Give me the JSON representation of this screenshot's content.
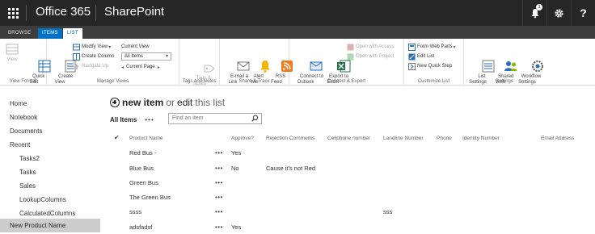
{
  "suite": {
    "app_launcher_icon": "waffle-icon",
    "office_title": "Office 365",
    "app_title": "SharePoint",
    "notification_count": "1",
    "icons": [
      "bell-icon",
      "gear-icon",
      "help-icon"
    ],
    "help_glyph": "?"
  },
  "ribbon_tabs": [
    {
      "label": "BROWSE"
    },
    {
      "label": "ITEMS"
    },
    {
      "label": "LIST"
    }
  ],
  "ribbon": {
    "view_format": {
      "label": "View Format",
      "view": "View",
      "quick_edit": "Quick\nEdit"
    },
    "manage_views": {
      "label": "Manage Views",
      "create_view": "Create\nView",
      "modify_view": "Modify View",
      "create_column": "Create Column",
      "navigate_up": "Navigate Up",
      "current_view_label": "Current View",
      "current_view_value": "All Items",
      "current_page": "Current Page"
    },
    "tags_notes": {
      "label": "Tags and Notes",
      "tags_notes_btn": "Tags &\nNotes"
    },
    "share_track": {
      "label": "Share & Track",
      "email_link": "E-mail a\nLink",
      "alert_me": "Alert\nMe",
      "rss_feed": "RSS\nFeed"
    },
    "connect_export": {
      "label": "Connect & Export",
      "connect_outlook": "Connect to\nOutlook",
      "export_excel": "Export to\nExcel",
      "open_access": "Open with Access",
      "open_project": "Open with Project"
    },
    "customize_list": {
      "label": "Customize List",
      "form_web_parts": "Form Web Parts",
      "edit_list": "Edit List",
      "new_quick_step": "New Quick Step"
    },
    "settings": {
      "label": "Settings",
      "list_settings": "List\nSettings",
      "shared_with": "Shared\nWith",
      "workflow_settings": "Workflow\nSettings"
    }
  },
  "leftnav": [
    {
      "label": "Home"
    },
    {
      "label": "Notebook"
    },
    {
      "label": "Documents"
    },
    {
      "label": "Recent"
    },
    {
      "label": "Tasks2"
    },
    {
      "label": "Tasks"
    },
    {
      "label": "Sales"
    },
    {
      "label": "LookupColumns"
    },
    {
      "label": "CalculatedColumns"
    },
    {
      "label": "New Product Name"
    }
  ],
  "main": {
    "new_item": "new item",
    "or": "or",
    "edit": "edit",
    "this_list": "this list",
    "view_name": "All Items",
    "view_menu": "•••",
    "search_placeholder": "Find an item"
  },
  "table": {
    "check_glyph": "✔",
    "columns": [
      "Product Name",
      "Approve?",
      "Rejection Comments",
      "Cellphone number",
      "Landline Number",
      "Phone",
      "Identity Number",
      "Email Address"
    ],
    "item_menu": "•••",
    "rows": [
      {
        "product": "Red Bus -",
        "approve": "Yes",
        "comments": "",
        "landline": ""
      },
      {
        "product": "Blue Bus",
        "approve": "No",
        "comments": "Cause it's not Red",
        "landline": ""
      },
      {
        "product": "Green Bus",
        "approve": "",
        "comments": "",
        "landline": ""
      },
      {
        "product": "The Green Bus",
        "approve": "",
        "comments": "",
        "landline": ""
      },
      {
        "product": "ssss",
        "approve": "",
        "comments": "",
        "landline": "sss"
      },
      {
        "product": "adsfadsf",
        "approve": "Yes",
        "comments": "",
        "landline": ""
      }
    ]
  }
}
